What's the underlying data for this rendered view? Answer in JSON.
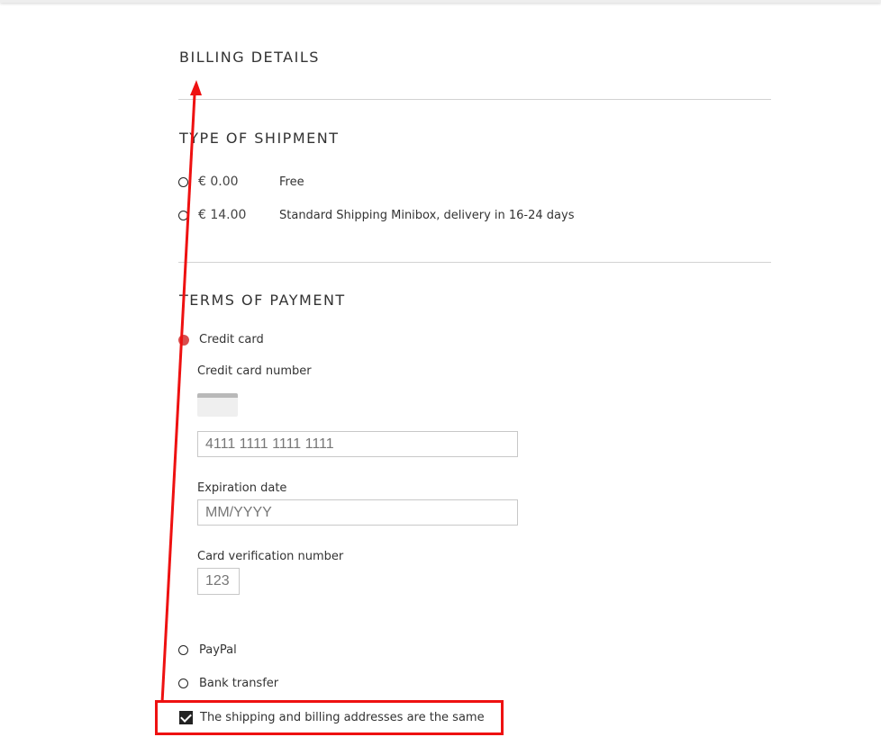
{
  "billing": {
    "title": "BILLING DETAILS"
  },
  "shipment": {
    "title": "TYPE OF SHIPMENT",
    "options": [
      {
        "price": "€ 0.00",
        "label": "Free",
        "selected": false
      },
      {
        "price": "€ 14.00",
        "label": "Standard Shipping Minibox, delivery in 16-24 days",
        "selected": false
      }
    ]
  },
  "payment": {
    "title": "TERMS OF PAYMENT",
    "credit_card": {
      "label": "Credit card",
      "selected": true,
      "number_label": "Credit card number",
      "number_placeholder": "4111 1111 1111 1111",
      "expiry_label": "Expiration date",
      "expiry_placeholder": "MM/YYYY",
      "cvv_label": "Card verification number",
      "cvv_placeholder": "123",
      "card_icon": "credit-card-icon"
    },
    "paypal": {
      "label": "PayPal",
      "selected": false
    },
    "bank": {
      "label": "Bank transfer",
      "selected": false
    }
  },
  "same_address": {
    "label": "The shipping and billing addresses are the same",
    "checked": true
  },
  "colors": {
    "accent": "#d94c4c",
    "annotation": "#ee1111",
    "divider": "#d2d2d2"
  },
  "icons": {
    "radio": "radio-icon",
    "checkbox": "checkmark-icon"
  }
}
